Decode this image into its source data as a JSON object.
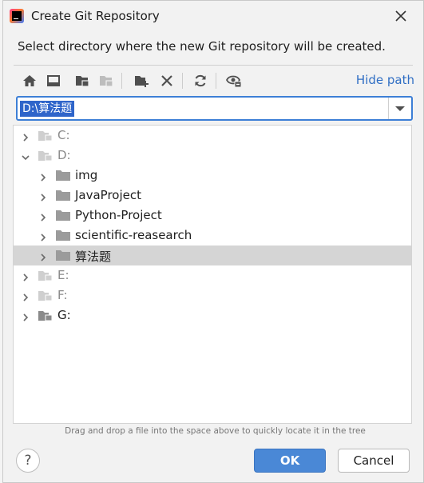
{
  "window": {
    "title": "Create Git Repository",
    "close_icon": "close-icon"
  },
  "description": "Select directory where the new Git repository will be created.",
  "toolbar": {
    "icons": [
      "home-icon",
      "desktop-icon",
      "project-folder-icon",
      "module-folder-icon",
      "new-folder-icon",
      "delete-icon",
      "refresh-icon",
      "show-hidden-icon"
    ],
    "hide_path_label": "Hide path"
  },
  "path_field": {
    "value": "D:\\算法题",
    "dropdown_icon": "chevron-down-icon"
  },
  "tree": {
    "items": [
      {
        "label": "C:",
        "kind": "drive",
        "expanded": false,
        "level": 0
      },
      {
        "label": "D:",
        "kind": "drive",
        "expanded": true,
        "level": 0
      },
      {
        "label": "img",
        "kind": "folder",
        "expanded": false,
        "level": 1
      },
      {
        "label": "JavaProject",
        "kind": "folder",
        "expanded": false,
        "level": 1
      },
      {
        "label": "Python-Project",
        "kind": "folder",
        "expanded": false,
        "level": 1
      },
      {
        "label": "scientific-reasearch",
        "kind": "folder",
        "expanded": false,
        "level": 1
      },
      {
        "label": "算法题",
        "kind": "folder",
        "expanded": false,
        "level": 1,
        "selected": true
      },
      {
        "label": "E:",
        "kind": "drive",
        "expanded": false,
        "level": 0
      },
      {
        "label": "F:",
        "kind": "drive",
        "expanded": false,
        "level": 0
      },
      {
        "label": "G:",
        "kind": "drive",
        "expanded": false,
        "level": 0
      }
    ]
  },
  "hint": "Drag and drop a file into the space above to quickly locate it in the tree",
  "buttons": {
    "help": "?",
    "ok": "OK",
    "cancel": "Cancel"
  },
  "colors": {
    "accent": "#4a88d6",
    "selection": "#2f65ca",
    "link": "#2f6ec4",
    "row_selected": "#d5d5d5"
  }
}
